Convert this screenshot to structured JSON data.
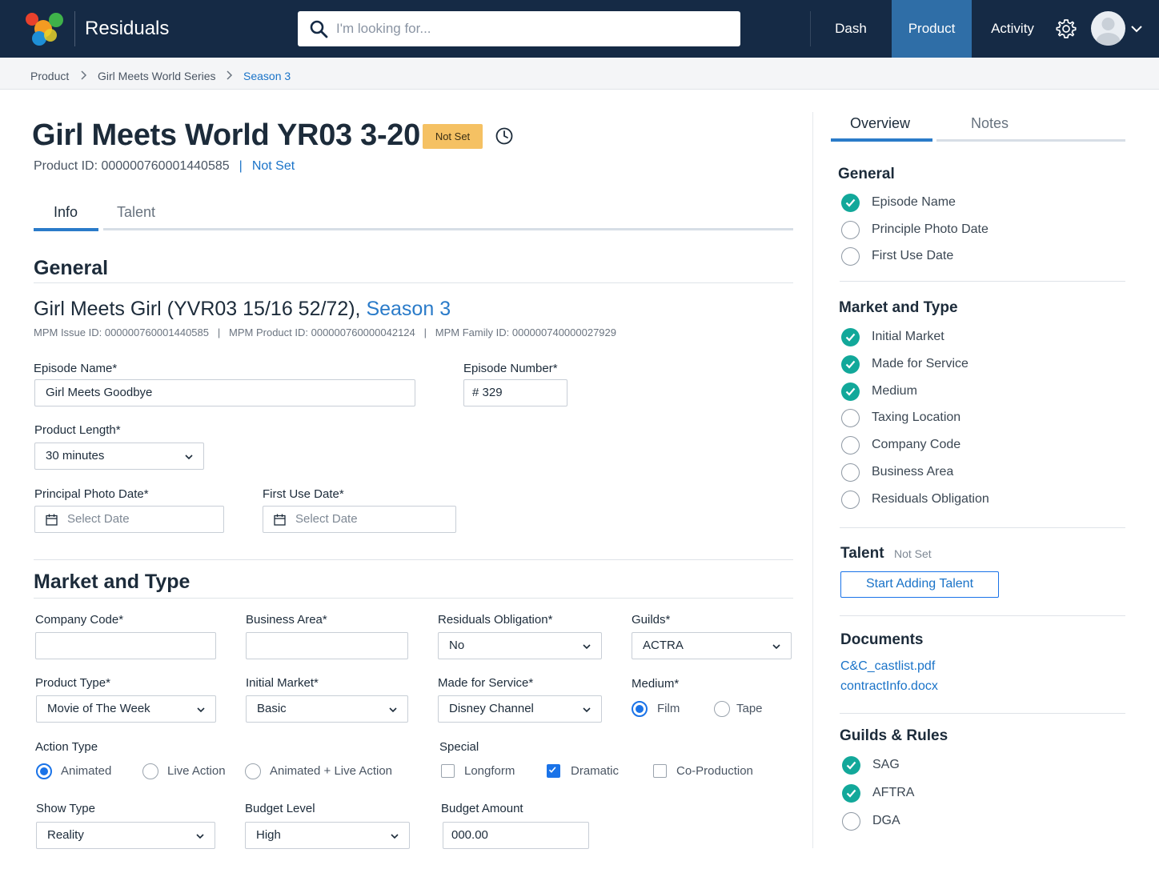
{
  "app": {
    "title": "Residuals"
  },
  "search": {
    "placeholder": "I'm looking for..."
  },
  "nav": {
    "items": [
      "Dash",
      "Product",
      "Activity"
    ],
    "active": "Product"
  },
  "breadcrumb": [
    "Product",
    "Girl Meets World Series",
    "Season 3"
  ],
  "page": {
    "title": "Girl Meets World YR03 3-20",
    "badge": "Not Set",
    "product_id": "Product ID: 000000760001440585",
    "status_link": "Not Set"
  },
  "tabs": [
    "Info",
    "Talent"
  ],
  "general": {
    "title": "General",
    "subtitle_main": "Girl Meets Girl (YVR03 15/16 52/72),",
    "subtitle_link": "Season 3",
    "meta": "MPM Issue ID: 000000760001440585   |   MPM Product ID: 000000760000042124   |   MPM Family ID: 000000740000027929",
    "episode_name_label": "Episode Name*",
    "episode_name_value": "Girl Meets Goodbye",
    "episode_number_label": "Episode Number*",
    "episode_number_value": "# 329",
    "product_length_label": "Product Length*",
    "product_length_value": "30 minutes",
    "principal_photo_label": "Principal Photo Date*",
    "first_use_label": "First Use Date*",
    "date_placeholder": "Select Date"
  },
  "market": {
    "title": "Market and Type",
    "company_code_label": "Company Code*",
    "business_area_label": "Business Area*",
    "residuals_label": "Residuals Obligation*",
    "residuals_value": "No",
    "guilds_label": "Guilds*",
    "guilds_value": "ACTRA",
    "product_type_label": "Product Type*",
    "product_type_value": "Movie of The Week",
    "initial_market_label": "Initial Market*",
    "initial_market_value": "Basic",
    "made_for_label": "Made for Service*",
    "made_for_value": "Disney Channel",
    "medium_label": "Medium*",
    "medium_options": [
      "Film",
      "Tape"
    ],
    "action_type_label": "Action Type",
    "action_options": [
      "Animated",
      "Live Action",
      "Animated + Live Action"
    ],
    "special_label": "Special",
    "special_options": [
      "Longform",
      "Dramatic",
      "Co-Production"
    ],
    "show_type_label": "Show Type",
    "show_type_value": "Reality",
    "budget_level_label": "Budget Level",
    "budget_level_value": "High",
    "budget_amount_label": "Budget Amount",
    "budget_amount_value": "000.00"
  },
  "right": {
    "tabs": [
      "Overview",
      "Notes"
    ],
    "general_title": "General",
    "general_items": [
      {
        "label": "Episode Name",
        "done": true
      },
      {
        "label": "Principle Photo Date",
        "done": false
      },
      {
        "label": "First Use Date",
        "done": false
      }
    ],
    "market_title": "Market and Type",
    "market_items": [
      {
        "label": "Initial Market",
        "done": true
      },
      {
        "label": "Made for Service",
        "done": true
      },
      {
        "label": "Medium",
        "done": true
      },
      {
        "label": "Taxing Location",
        "done": false
      },
      {
        "label": "Company Code",
        "done": false
      },
      {
        "label": "Business Area",
        "done": false
      },
      {
        "label": "Residuals Obligation",
        "done": false
      }
    ],
    "talent_title": "Talent",
    "talent_status": "Not Set",
    "talent_button": "Start Adding Talent",
    "documents_title": "Documents",
    "documents": [
      "C&C_castlist.pdf",
      "contractInfo.docx"
    ],
    "guilds_title": "Guilds & Rules",
    "guild_items": [
      {
        "label": "SAG",
        "done": true
      },
      {
        "label": "AFTRA",
        "done": true
      },
      {
        "label": "DGA",
        "done": false
      }
    ]
  },
  "colors": {
    "header": "#152a45",
    "active_nav": "#2f6ea7",
    "accent": "#1a73e8",
    "success": "#12a89a",
    "badge": "#f5c163"
  }
}
